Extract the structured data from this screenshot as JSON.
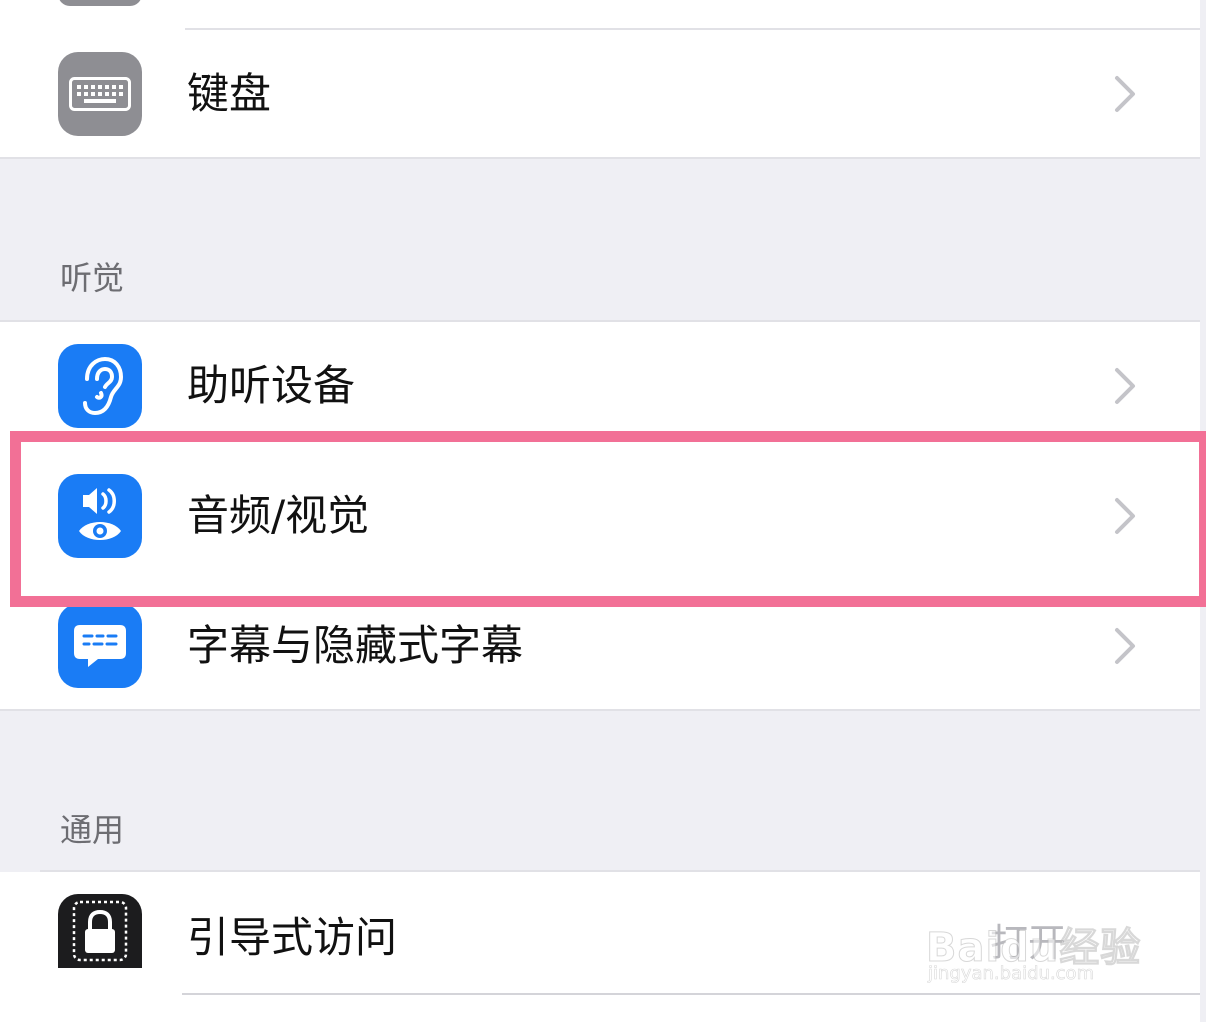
{
  "rows": {
    "keyboard": {
      "label": "键盘",
      "icon": "keyboard-icon",
      "icon_bg": "#8e8e93"
    },
    "hearing_devices": {
      "label": "助听设备",
      "icon": "ear-icon",
      "icon_bg": "#1a7cf5"
    },
    "audio_visual": {
      "label": "音频/视觉",
      "icon": "speaker-eye-icon",
      "icon_bg": "#1a7cf5",
      "highlighted": true
    },
    "subtitles": {
      "label": "字幕与隐藏式字幕",
      "icon": "caption-bubble-icon",
      "icon_bg": "#1a7cf5"
    },
    "guided_access": {
      "label": "引导式访问",
      "icon": "lock-icon",
      "icon_bg": "#1c1c1e",
      "value": "打开"
    }
  },
  "headers": {
    "hearing": "听觉",
    "general": "通用"
  },
  "watermark": {
    "brand": "Baidu经验",
    "url": "jingyan.baidu.com"
  },
  "colors": {
    "highlight": "#f27096",
    "background": "#efeff4",
    "chevron": "#c4c4c9"
  }
}
